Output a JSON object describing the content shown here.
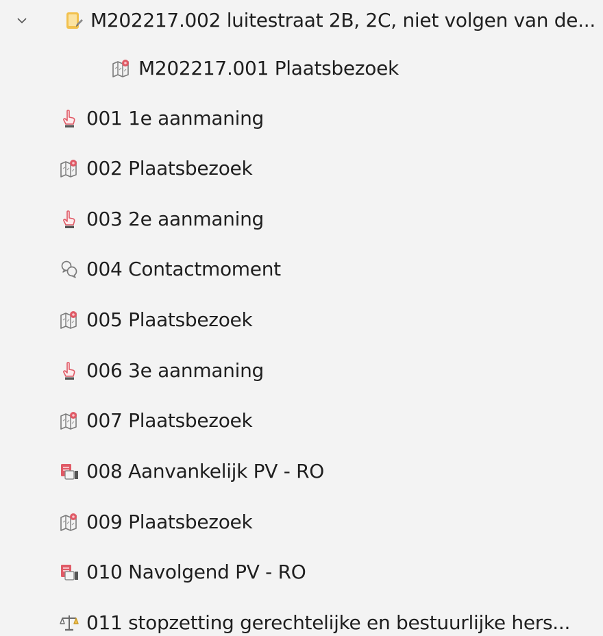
{
  "tree": {
    "root": {
      "label": "M202217.002 luitestraat 2B, 2C, niet volgen van de...",
      "icon": "folder-note-icon",
      "expanded": true
    },
    "child": {
      "label": "M202217.001 Plaatsbezoek",
      "icon": "map-pin-icon"
    },
    "items": [
      {
        "label": "001 1e aanmaning",
        "icon": "hand-pointer-icon"
      },
      {
        "label": "002 Plaatsbezoek",
        "icon": "map-pin-icon"
      },
      {
        "label": "003 2e aanmaning",
        "icon": "hand-pointer-icon"
      },
      {
        "label": "004 Contactmoment",
        "icon": "chat-bubbles-icon"
      },
      {
        "label": "005 Plaatsbezoek",
        "icon": "map-pin-icon"
      },
      {
        "label": "006 3e aanmaning",
        "icon": "hand-pointer-icon"
      },
      {
        "label": "007 Plaatsbezoek",
        "icon": "map-pin-icon"
      },
      {
        "label": "008 Aanvankelijk PV - RO",
        "icon": "report-stamp-icon"
      },
      {
        "label": "009 Plaatsbezoek",
        "icon": "map-pin-icon"
      },
      {
        "label": "010 Navolgend PV - RO",
        "icon": "report-stamp-icon"
      },
      {
        "label": "011 stopzetting gerechtelijke en bestuurlijke hers...",
        "icon": "scales-icon"
      }
    ]
  },
  "colors": {
    "background": "#f3f3f3",
    "text": "#1f1f1f",
    "folder_yellow": "#f2c14e",
    "icon_red": "#e05a66",
    "icon_gray": "#8a8a8a"
  }
}
